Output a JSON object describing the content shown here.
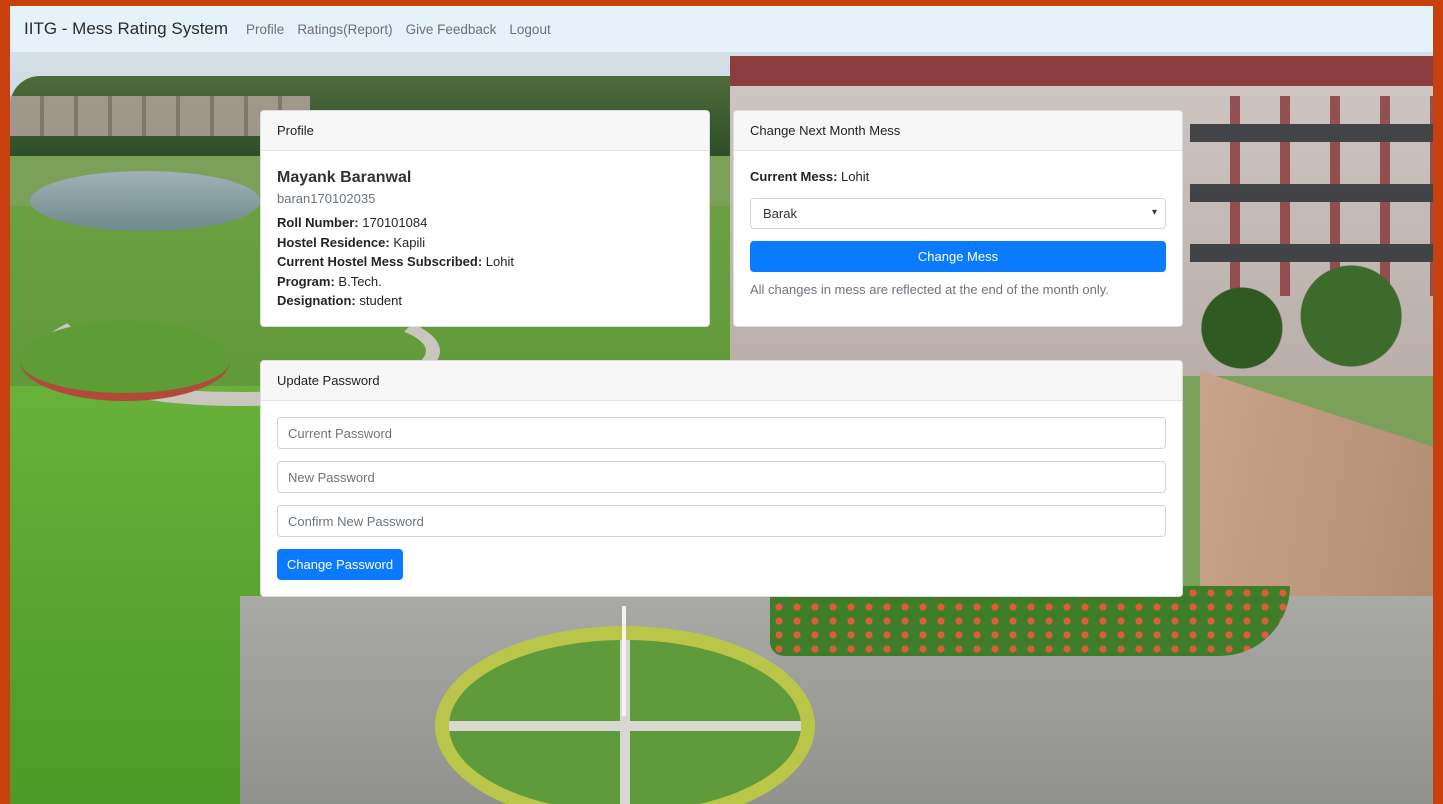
{
  "navbar": {
    "brand": "IITG - Mess Rating System",
    "links": [
      "Profile",
      "Ratings(Report)",
      "Give Feedback",
      "Logout"
    ]
  },
  "profile_card": {
    "header": "Profile",
    "name": "Mayank Baranwal",
    "username": "baran170102035",
    "fields": [
      {
        "label": "Roll Number:",
        "value": "170101084"
      },
      {
        "label": "Hostel Residence:",
        "value": "Kapili"
      },
      {
        "label": "Current Hostel Mess Subscribed:",
        "value": "Lohit"
      },
      {
        "label": "Program:",
        "value": "B.Tech."
      },
      {
        "label": "Designation:",
        "value": "student"
      }
    ]
  },
  "mess_card": {
    "header": "Change Next Month Mess",
    "current_label": "Current Mess:",
    "current_value": "Lohit",
    "selected_option": "Barak",
    "button_label": "Change Mess",
    "note": "All changes in mess are reflected at the end of the month only."
  },
  "password_card": {
    "header": "Update Password",
    "current_placeholder": "Current Password",
    "new_placeholder": "New Password",
    "confirm_placeholder": "Confirm New Password",
    "button_label": "Change Password"
  },
  "colors": {
    "primary": "#0a7bff",
    "navbar_bg": "#e6f2fa",
    "border_frame": "#c9400f"
  }
}
